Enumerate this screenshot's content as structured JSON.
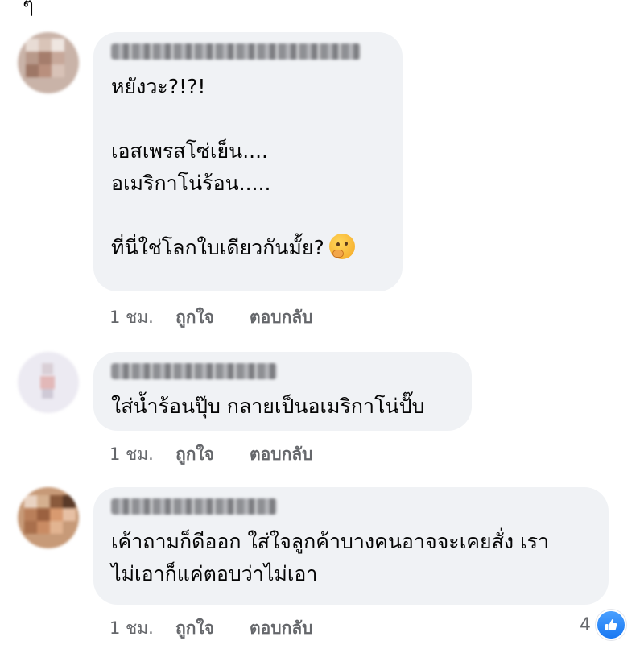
{
  "comments": [
    {
      "lines": [
        "หยังวะ?!?!",
        "",
        "เอสเพรสโซ่เย็น....",
        "อเมริกาโน่ร้อน.....",
        "",
        "ที่นี่ใช่โลกใบเดียวกันมั้ย?"
      ],
      "has_emoji": true,
      "emoji": "thinking-face",
      "time": "1 ชม.",
      "like": "ถูกใจ",
      "reply": "ตอบกลับ"
    },
    {
      "lines": [
        "ใส่น้ำร้อนปุ๊บ กลายเป็นอเมริกาโน่ปั๊บ"
      ],
      "time": "1 ชม.",
      "like": "ถูกใจ",
      "reply": "ตอบกลับ"
    },
    {
      "lines": [
        "เค้าถามก็ดีออก ใส่ใจลูกค้าบางคนอาจจะเคยสั่ง เรา",
        "ไม่เอาก็แค่ตอบว่าไม่เอา"
      ],
      "time": "1 ชม.",
      "like": "ถูกใจ",
      "reply": "ตอบกลับ"
    }
  ],
  "reactions": {
    "count": "4",
    "icon": "thumbs-up-icon",
    "color": "#1877f2"
  }
}
